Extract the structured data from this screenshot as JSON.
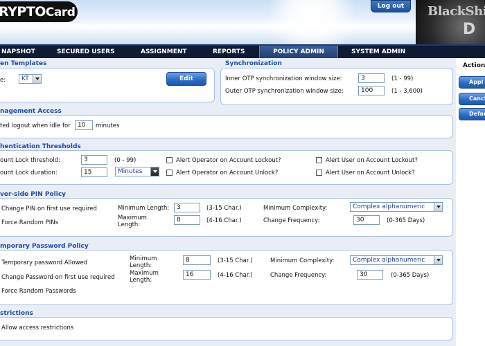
{
  "header": {
    "logo_left": "RYPTO",
    "logo_right": "Card",
    "logout_label": "Log out",
    "brand_text": "BlackShi",
    "brand_sub": "D"
  },
  "nav": {
    "items": [
      "NAPSHOT",
      "SECURED USERS",
      "ASSIGNMENT",
      "REPORTS",
      "POLICY ADMIN",
      "SYSTEM ADMIN"
    ],
    "active": "POLICY ADMIN"
  },
  "token_templates": {
    "title": "en Templates",
    "type_label": "e:",
    "type_value": "KT",
    "edit_label": "Edit"
  },
  "synchronization": {
    "title": "Synchronization",
    "inner_label": "Inner OTP synchronization window size:",
    "inner_value": "3",
    "inner_range": "(1 - 99)",
    "outer_label": "Outer OTP synchronization window size:",
    "outer_value": "100",
    "outer_range": "(1 - 3,600)"
  },
  "management": {
    "title": "nagement Access",
    "logout_label": "ted logout when idle for",
    "logout_value": "10",
    "logout_unit": "minutes"
  },
  "auth": {
    "title": "hentication Thresholds",
    "threshold_label": "ount Lock threshold:",
    "threshold_value": "3",
    "threshold_range": "(0 - 99)",
    "duration_label": "ount Lock duration:",
    "duration_value": "15",
    "duration_unit": "Minutes",
    "alert_op_lockout": "Alert Operator on Account Lockout?",
    "alert_op_unlock": "Alert Operator on Account Unlock?",
    "alert_user_lockout": "Alert User on Account Lockout?",
    "alert_user_unlock": "Alert User on Account Unlock?"
  },
  "pin": {
    "title": "ver-side PIN Policy",
    "change_first": "Change PIN on first use required",
    "force_random": "Force Random PINs",
    "min_length_label": "Minimum Length:",
    "min_length_value": "3",
    "min_length_range": "(3-15 Char.)",
    "max_length_label": "Maximum Length:",
    "max_length_value": "8",
    "max_length_range": "(4-16 Char.)",
    "complexity_label": "Minimum Complexity:",
    "complexity_value": "Complex alphanumeric",
    "frequency_label": "Change Frequency:",
    "frequency_value": "30",
    "frequency_range": "(0-365 Days)"
  },
  "temp_pw": {
    "title": "mporary Password Policy",
    "allowed": "Temporary password Allowed",
    "change_first": "Change Password on first use required",
    "force_random": "Force Random Passwords",
    "min_length_label": "Minimum Length:",
    "min_length_value": "8",
    "min_length_range": "(3-15 Char.)",
    "max_length_label": "Maximum Length:",
    "max_length_value": "16",
    "max_length_range": "(4-16 Char.)",
    "complexity_label": "Minimum Complexity:",
    "complexity_value": "Complex alphanumeric",
    "frequency_label": "Change Frequency:",
    "frequency_value": "30",
    "frequency_range": "(0-365 Days)"
  },
  "restrictions": {
    "title": "strictions",
    "allow": "Allow access restrictions"
  },
  "actions": {
    "title": "Action",
    "apply": "Appl",
    "cancel": "Cancl",
    "default": "Defau"
  }
}
